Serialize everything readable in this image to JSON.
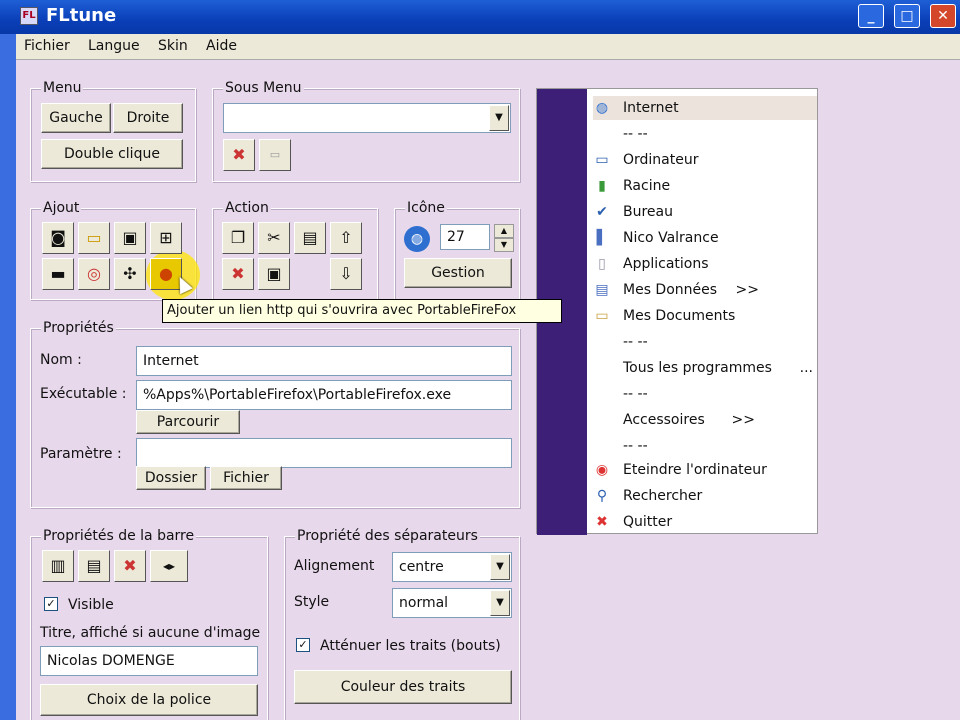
{
  "window": {
    "title": "FLtune"
  },
  "menubar": [
    "Fichier",
    "Langue",
    "Skin",
    "Aide"
  ],
  "menu_group": {
    "label": "Menu",
    "left": "Gauche",
    "right": "Droite",
    "double": "Double clique"
  },
  "sousmenu_group": {
    "label": "Sous Menu",
    "value": ""
  },
  "ajout_group": {
    "label": "Ajout"
  },
  "action_group": {
    "label": "Action"
  },
  "icone_group": {
    "label": "Icône",
    "value": "27",
    "gestion": "Gestion"
  },
  "tooltip": "Ajouter un lien http qui s'ouvrira avec PortableFireFox",
  "props": {
    "label": "Propriétés",
    "nom_label": "Nom :",
    "nom": "Internet",
    "exe_label": "Exécutable :",
    "exe": "%Apps%\\PortableFirefox\\PortableFirefox.exe",
    "parcourir": "Parcourir",
    "param_label": "Paramètre :",
    "param": "",
    "dossier": "Dossier",
    "fichier": "Fichier"
  },
  "barre": {
    "label": "Propriétés de la barre",
    "visible": "Visible",
    "titre_label": "Titre, affiché si aucune d'image",
    "titre": "Nicolas DOMENGE",
    "police": "Choix de la police"
  },
  "sep": {
    "label": "Propriété des séparateurs",
    "align_label": "Alignement",
    "align": "centre",
    "style_label": "Style",
    "style": "normal",
    "attenuer": "Atténuer les traits (bouts)",
    "couleur": "Couleur des traits"
  },
  "preview": [
    {
      "icon": "globe-icon",
      "text": "Internet",
      "extra": ""
    },
    {
      "icon": "",
      "text": "-- --",
      "extra": ""
    },
    {
      "icon": "computer-icon",
      "text": "Ordinateur",
      "extra": ""
    },
    {
      "icon": "usb-icon",
      "text": "Racine",
      "extra": ""
    },
    {
      "icon": "check-icon",
      "text": "Bureau",
      "extra": ""
    },
    {
      "icon": "book-icon",
      "text": "Nico Valrance",
      "extra": ""
    },
    {
      "icon": "page-icon",
      "text": "Applications",
      "extra": ""
    },
    {
      "icon": "folder-icon",
      "text": "Mes Données",
      "extra": ">>"
    },
    {
      "icon": "docs-icon",
      "text": "Mes Documents",
      "extra": ""
    },
    {
      "icon": "",
      "text": "-- --",
      "extra": ""
    },
    {
      "icon": "",
      "text": "Tous les programmes",
      "extra": "..."
    },
    {
      "icon": "",
      "text": "-- --",
      "extra": ""
    },
    {
      "icon": "",
      "text": "Accessoires",
      "extra": ">>"
    },
    {
      "icon": "",
      "text": "-- --",
      "extra": ""
    },
    {
      "icon": "power-icon",
      "text": "Eteindre l'ordinateur",
      "extra": ""
    },
    {
      "icon": "search-icon",
      "text": "Rechercher",
      "extra": ""
    },
    {
      "icon": "close-icon",
      "text": "Quitter",
      "extra": ""
    }
  ]
}
